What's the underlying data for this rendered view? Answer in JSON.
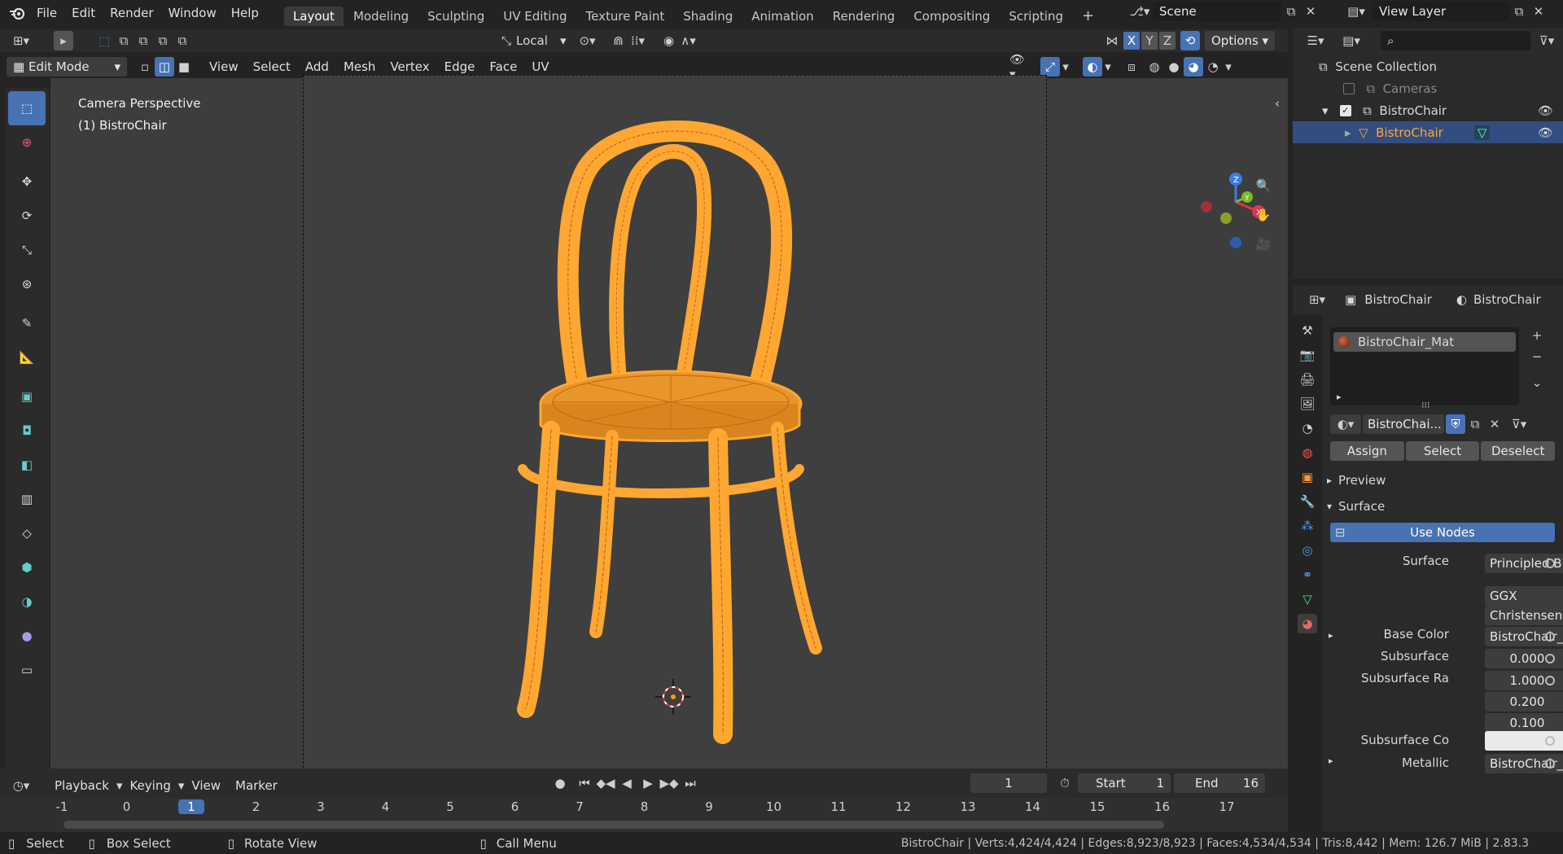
{
  "menu": [
    "File",
    "Edit",
    "Render",
    "Window",
    "Help"
  ],
  "workspaces": [
    "Layout",
    "Modeling",
    "Sculpting",
    "UV Editing",
    "Texture Paint",
    "Shading",
    "Animation",
    "Rendering",
    "Compositing",
    "Scripting"
  ],
  "scene": "Scene",
  "view_layer": "View Layer",
  "transform_orientation": "Local",
  "axes": [
    "X",
    "Y",
    "Z"
  ],
  "options_label": "Options",
  "mode": "Edit Mode",
  "vp_menu": [
    "View",
    "Select",
    "Add",
    "Mesh",
    "Vertex",
    "Edge",
    "Face",
    "UV"
  ],
  "overlay_text": {
    "perspective": "Camera Perspective",
    "object": "(1) BistroChair"
  },
  "outliner": {
    "root": "Scene Collection",
    "items": [
      {
        "label": "Cameras"
      },
      {
        "label": "BistroChair"
      },
      {
        "label": "BistroChair"
      }
    ]
  },
  "props": {
    "object_name": "BistroChair",
    "material_tab": "BistroChair",
    "slot": "BistroChair_Mat",
    "material_field": "BistroChai...",
    "assign": "Assign",
    "select": "Select",
    "deselect": "Deselect",
    "preview": "Preview",
    "surface_panel": "Surface",
    "use_nodes": "Use Nodes",
    "rows": [
      {
        "label": "Surface",
        "value": "Principled B..."
      },
      {
        "label": "",
        "value": "GGX"
      },
      {
        "label": "",
        "value": "Christensen-B..."
      },
      {
        "label": "Base Color",
        "value": "BistroChair_..."
      },
      {
        "label": "Subsurface",
        "value": "0.000"
      },
      {
        "label": "Subsurface Ra",
        "value": "1.000"
      },
      {
        "label": "",
        "value": "0.200"
      },
      {
        "label": "",
        "value": "0.100"
      },
      {
        "label": "Subsurface Co",
        "value": ""
      },
      {
        "label": "Metallic",
        "value": "BistroChair_..."
      }
    ]
  },
  "timeline": {
    "menu": [
      "Playback",
      "Keying",
      "View",
      "Marker"
    ],
    "current_frame": "1",
    "start_label": "Start",
    "start": "1",
    "end_label": "End",
    "end": "16",
    "ticks": [
      "-1",
      "0",
      "1",
      "2",
      "3",
      "4",
      "5",
      "6",
      "7",
      "8",
      "9",
      "10",
      "11",
      "12",
      "13",
      "14",
      "15",
      "16",
      "17"
    ]
  },
  "status": {
    "select": "Select",
    "box_select": "Box Select",
    "rotate": "Rotate View",
    "call_menu": "Call Menu",
    "stats": "BistroChair | Verts:4,424/4,424 | Edges:8,923/8,923 | Faces:4,534/4,534 | Tris:8,442 | Mem: 126.7 MiB | 2.83.3"
  },
  "colors": {
    "accent": "#4772b3",
    "selection": "#ffa732",
    "wire": "#f29a1a"
  }
}
